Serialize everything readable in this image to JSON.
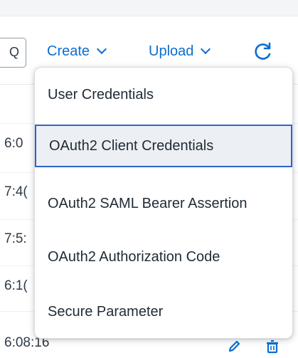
{
  "toolbar": {
    "search_glyph": "Q",
    "create_label": "Create",
    "upload_label": "Upload"
  },
  "table": {
    "rows": [
      {
        "time": "6:0"
      },
      {
        "time": "7:4("
      },
      {
        "time": "7:5:"
      },
      {
        "time": "6:1("
      },
      {
        "time": "6:08:16"
      }
    ]
  },
  "create_menu": {
    "items": [
      {
        "label": "User Credentials"
      },
      {
        "label": "OAuth2 Client Credentials",
        "selected": true
      },
      {
        "label": "OAuth2 SAML Bearer Assertion"
      },
      {
        "label": "OAuth2 Authorization Code"
      },
      {
        "label": "Secure Parameter"
      }
    ]
  },
  "icons": {
    "search": "search-icon",
    "chevron": "chevron-down-icon",
    "refresh": "refresh-icon",
    "edit": "pencil-icon",
    "delete": "trash-icon"
  },
  "colors": {
    "accent": "#0a6ed1",
    "selection_border": "#2f64c8",
    "selection_bg": "#eceff3"
  }
}
